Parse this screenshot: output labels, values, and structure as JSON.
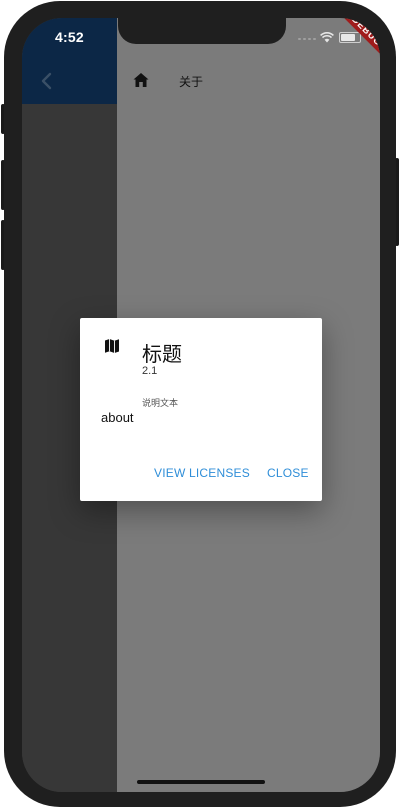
{
  "status_bar": {
    "time": "4:52",
    "debug_label": "DEBUG"
  },
  "app_bar": {
    "title": "关于",
    "back_icon": "chevron-left-icon",
    "home_icon": "home-icon"
  },
  "dialog": {
    "icon": "map-icon",
    "title": "标题",
    "version": "2.1",
    "legalese": "说明文本",
    "content": "about",
    "view_licenses_label": "VIEW LICENSES",
    "close_label": "CLOSE"
  },
  "colors": {
    "accent": "#2f8ed8",
    "app_bar_left": "#0c2746",
    "scrim_right": "#7b7b7b",
    "scrim_left": "#373737",
    "debug_ribbon": "#a01c1c"
  }
}
